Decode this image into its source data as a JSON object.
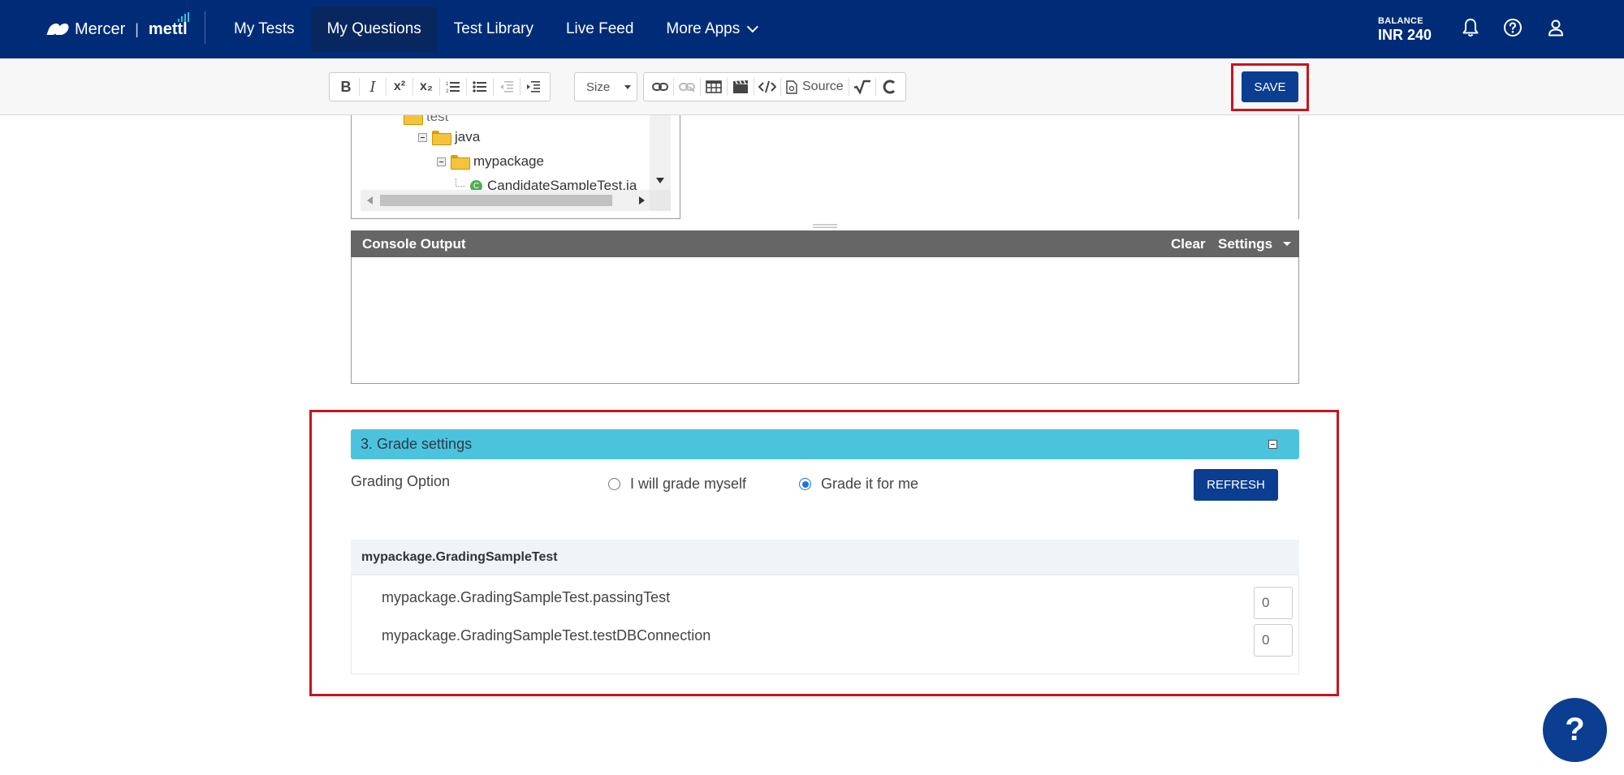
{
  "nav": {
    "logo_mercer": "Mercer",
    "logo_sep": "|",
    "logo_mettl": "mettl",
    "items": [
      {
        "label": "My Tests"
      },
      {
        "label": "My Questions"
      },
      {
        "label": "Test Library"
      },
      {
        "label": "Live Feed"
      },
      {
        "label": "More Apps"
      }
    ],
    "balance_label": "BALANCE",
    "balance_value": "INR 240",
    "icons": [
      "bell-icon",
      "help-circle-icon",
      "user-icon"
    ]
  },
  "toolbar": {
    "bold": "B",
    "italic": "I",
    "superscript": "x²",
    "subscript": "x₂",
    "size_label": "Size",
    "source_label": "Source",
    "save_label": "SAVE"
  },
  "tree": {
    "items": [
      {
        "label": "test"
      },
      {
        "label": "java"
      },
      {
        "label": "mypackage"
      },
      {
        "label": "CandidateSampleTest.ja"
      }
    ]
  },
  "console": {
    "title": "Console Output",
    "clear_label": "Clear",
    "settings_label": "Settings"
  },
  "grade": {
    "title": "3. Grade settings",
    "option_label": "Grading Option",
    "options": [
      {
        "label": "I will grade myself",
        "checked": false
      },
      {
        "label": "Grade it for me",
        "checked": true
      }
    ],
    "refresh_label": "REFRESH",
    "test_class": "mypackage.GradingSampleTest",
    "tests": [
      {
        "name": "mypackage.GradingSampleTest.passingTest",
        "score": "0"
      },
      {
        "name": "mypackage.GradingSampleTest.testDBConnection",
        "score": "0"
      }
    ]
  },
  "help": {
    "label": "?"
  },
  "colors": {
    "nav_bg": "#002c77",
    "primary_button": "#0b3d91",
    "section_header": "#4cc3dc",
    "highlight": "#c8141e"
  }
}
